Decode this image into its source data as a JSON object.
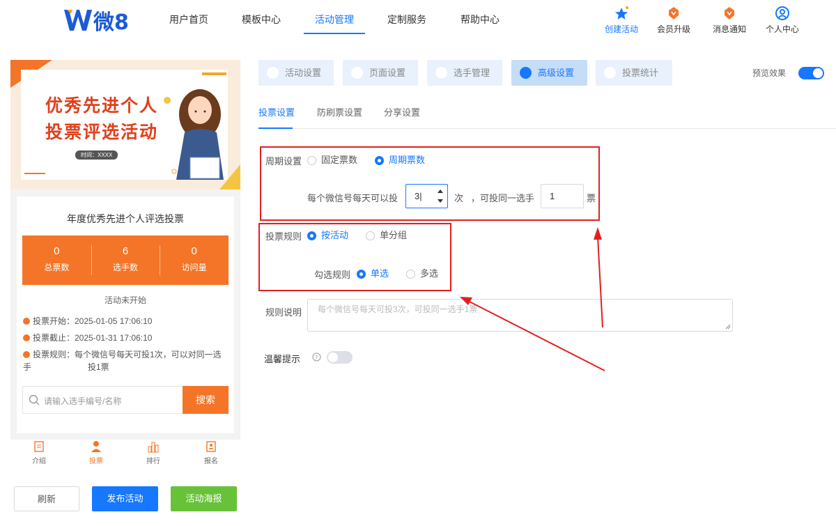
{
  "header": {
    "logo_text": "微8",
    "nav": [
      "用户首页",
      "模板中心",
      "活动管理",
      "定制服务",
      "帮助中心"
    ],
    "tools": [
      {
        "label": "创建活动",
        "icon": "stars-icon"
      },
      {
        "label": "会员升级",
        "icon": "diamond-icon"
      },
      {
        "label": "消息通知",
        "icon": "bell-diamond-icon"
      },
      {
        "label": "个人中心",
        "icon": "user-circle-icon"
      }
    ]
  },
  "preview": {
    "banner_title_1": "优秀先进个人",
    "banner_title_2": "投票评选活动",
    "banner_time": "时间：XXXX",
    "activity_title": "年度优秀先进个人评选投票",
    "stats": [
      {
        "value": "0",
        "label": "总票数"
      },
      {
        "value": "6",
        "label": "选手数"
      },
      {
        "value": "0",
        "label": "访问量"
      }
    ],
    "status": "活动未开始",
    "vote_start": "投票开始：2025-01-05 17:06:10",
    "vote_end": "投票截止：2025-01-31 17:06:10",
    "vote_rule_1": "投票规则：每个微信号每天可投1次，可以对同一选手",
    "vote_rule_2": "投1票",
    "search_placeholder": "请输入选手编号/名称",
    "search_button": "搜索",
    "tabs": [
      "介绍",
      "投票",
      "排行",
      "报名"
    ]
  },
  "buttons": {
    "refresh": "刷新",
    "publish": "发布活动",
    "poster": "活动海报"
  },
  "steps": [
    "活动设置",
    "页面设置",
    "选手管理",
    "高级设置",
    "投票统计"
  ],
  "preview_toggle_label": "预览效果",
  "sub_tabs": [
    "投票设置",
    "防刷票设置",
    "分享设置"
  ],
  "form": {
    "cycle_label": "周期设置",
    "cycle_opt_fixed": "固定票数",
    "cycle_opt_cycle": "周期票数",
    "daily_text": "每个微信号每天可以投",
    "daily_value": "3",
    "unit_times": "次",
    "same_text": "，可投同一选手",
    "same_value": "1",
    "unit_votes": "票",
    "rule_label": "投票规则",
    "rule_opt_activity": "按活动",
    "rule_opt_group": "单分组",
    "check_label": "勾选规则",
    "check_opt_single": "单选",
    "check_opt_multi": "多选",
    "desc_label": "规则说明",
    "desc_placeholder": "每个微信号每天可投3次，可投同一选手1票",
    "tip_label": "温馨提示"
  },
  "colors": {
    "accent": "#1677ff",
    "orange": "#f47527",
    "red": "#e02020",
    "green": "#67c23a"
  }
}
